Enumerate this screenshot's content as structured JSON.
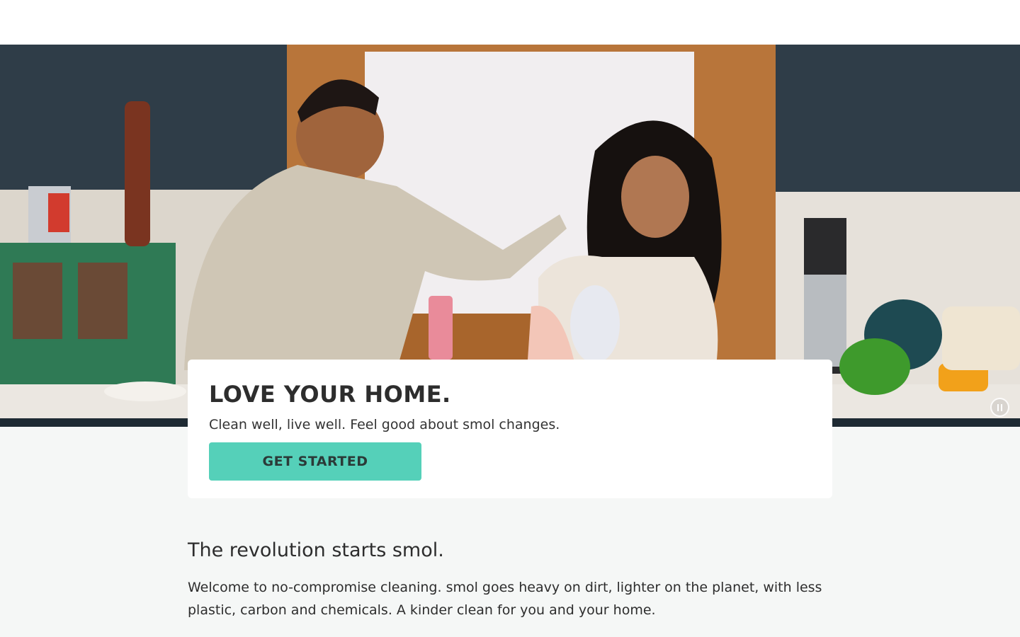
{
  "hero": {
    "image": "couple laughing while washing dishes in a kitchen",
    "pause_icon": "pause-icon"
  },
  "card": {
    "title": "LOVE YOUR HOME.",
    "subtitle": "Clean well, live well. Feel good about smol changes.",
    "cta_label": "GET STARTED",
    "cta_color": "#55d0b9"
  },
  "intro": {
    "heading": "The revolution starts smol.",
    "body": "Welcome to no-compromise cleaning. smol goes heavy on dirt, lighter on the planet, with less plastic, carbon and chemicals. A kinder clean for you and your home."
  },
  "colors": {
    "page_bg": "#f5f7f6",
    "wall": "#2f3d48",
    "accent": "#55d0b9"
  }
}
